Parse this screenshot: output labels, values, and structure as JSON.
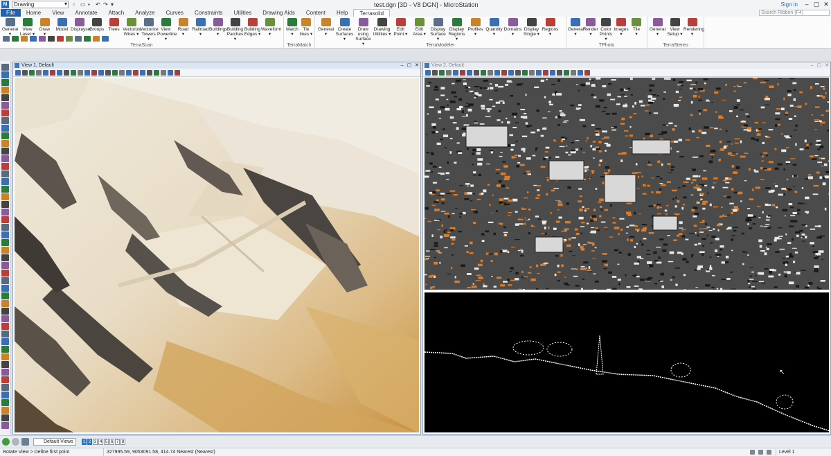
{
  "window": {
    "doc_title": "test.dgn [3D - V8 DGN] - MicroStation",
    "workflow": "Drawing",
    "sign_in": "Sign in",
    "search_placeholder": "Search Ribbon (F4)",
    "app_logo": "M"
  },
  "tabs": {
    "file": "File",
    "items": [
      "Home",
      "View",
      "Annotate",
      "Attach",
      "Analyze",
      "Curves",
      "Constraints",
      "Utilities",
      "Drawing Aids",
      "Content",
      "Help",
      "Terrasolid"
    ],
    "active": "Terrasolid"
  },
  "ribbon": {
    "groups": [
      {
        "label": "TerraScan",
        "buttons": [
          [
            "General",
            "▾"
          ],
          [
            "View",
            "Laser ▾"
          ],
          [
            "Draw",
            "▾"
          ],
          [
            "Model",
            ""
          ],
          [
            "Displayset",
            ""
          ],
          [
            "Groups",
            ""
          ],
          [
            "Trees",
            ""
          ],
          [
            "Vectorize",
            "Wires ▾"
          ],
          [
            "Vectorize",
            "Towers ▾"
          ],
          [
            "View",
            "Powerline ▾"
          ],
          [
            "Road",
            "▾"
          ],
          [
            "Railroad",
            "▾"
          ],
          [
            "Buildings",
            "▾"
          ],
          [
            "Building",
            "Patches ▾"
          ],
          [
            "Building",
            "Edges ▾"
          ],
          [
            "Waveform",
            "▾"
          ]
        ]
      },
      {
        "label": "TerraMatch",
        "buttons": [
          [
            "Match",
            "▾"
          ],
          [
            "Tie",
            "lines ▾"
          ]
        ]
      },
      {
        "label": "TerraModeler",
        "buttons": [
          [
            "General",
            "▾"
          ],
          [
            "Create",
            "Surfaces ▾"
          ],
          [
            "Draw",
            "using Surface ▾"
          ],
          [
            "Drawing",
            "Utilities ▾"
          ],
          [
            "Edit",
            "Point ▾"
          ],
          [
            "Edit",
            "Area ▾"
          ],
          [
            "Display",
            "Surface ▾"
          ],
          [
            "Display",
            "Regions ▾"
          ],
          [
            "Profiles",
            "▾"
          ],
          [
            "Quantity",
            "▾"
          ],
          [
            "Domains",
            "▾"
          ],
          [
            "Display",
            "Single ▾"
          ],
          [
            "Regions",
            "▾"
          ]
        ]
      },
      {
        "label": "TPhoto",
        "buttons": [
          [
            "General",
            "▾"
          ],
          [
            "Render",
            "▾"
          ],
          [
            "Color",
            "Points ▾"
          ],
          [
            "Images",
            "▾"
          ],
          [
            "Tile",
            "▾"
          ]
        ]
      },
      {
        "label": "TerraStereo",
        "buttons": [
          [
            "General",
            "▾"
          ],
          [
            "View",
            "Setup ▾"
          ],
          [
            "Rendering",
            "▾"
          ]
        ]
      }
    ]
  },
  "views": {
    "view1_title": "View 1, Default",
    "view2_title": "View 2, Default"
  },
  "bottom": {
    "views_select": "Default Views",
    "view_numbers": [
      "1",
      "2",
      "3",
      "4",
      "5",
      "6",
      "7",
      "8"
    ],
    "prompt": "Rotate View > Define first point",
    "coordinates": "327995.59, 9053091.58, 414.74 Nearest (Nearest)",
    "level": "Level 1"
  },
  "colors": {
    "accent": "#1f62ad",
    "terrain_light": "#eae2d3",
    "terrain_dark": "#c8943f",
    "points_orange": "#e07b25"
  }
}
